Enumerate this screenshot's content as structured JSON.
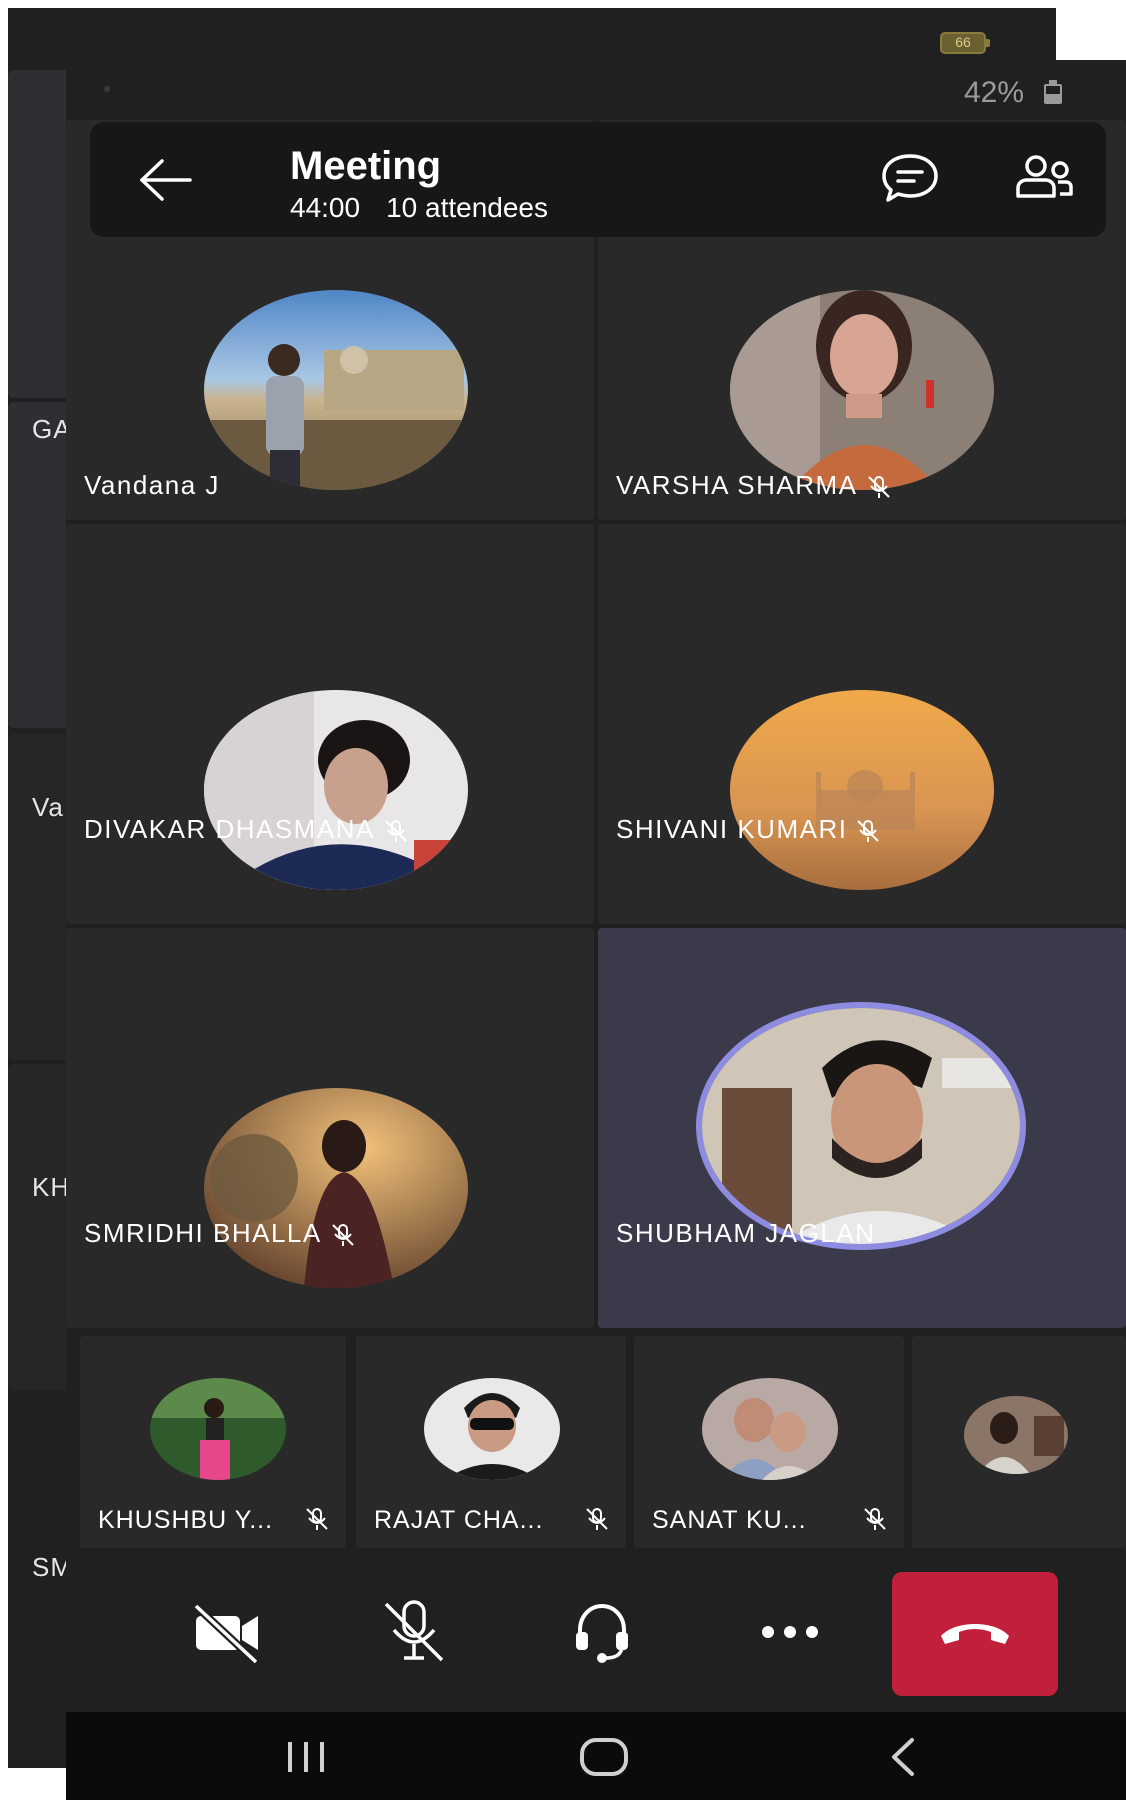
{
  "back_screen": {
    "battery_level": "66",
    "side_labels": [
      "GA",
      "Va",
      "KH",
      "SM"
    ]
  },
  "status_bar": {
    "battery": "42%"
  },
  "header": {
    "title": "Meeting",
    "duration": "44:00",
    "attendees": "10 attendees"
  },
  "participants": [
    {
      "name": "Vandana J",
      "muted": false
    },
    {
      "name": "VARSHA SHARMA",
      "muted": true
    },
    {
      "name": "DIVAKAR DHASMANA",
      "muted": true
    },
    {
      "name": "SHIVANI KUMARI",
      "muted": true
    },
    {
      "name": "SMRIDHI BHALLA",
      "muted": true
    },
    {
      "name": "SHUBHAM JAGLAN",
      "muted": false,
      "active_speaker": true
    }
  ],
  "small_participants": [
    {
      "name": "KHUSHBU Y...",
      "muted": true
    },
    {
      "name": "RAJAT CHA...",
      "muted": true
    },
    {
      "name": "SANAT KU...",
      "muted": true
    }
  ],
  "controls": [
    "camera-off",
    "mic-off",
    "audio",
    "more",
    "hang-up"
  ],
  "colors": {
    "background": "#202020",
    "tile": "#292929",
    "active_tile": "#3b3a4b",
    "speaker_ring": "#8e8ce0",
    "hangup": "#c1203c"
  }
}
